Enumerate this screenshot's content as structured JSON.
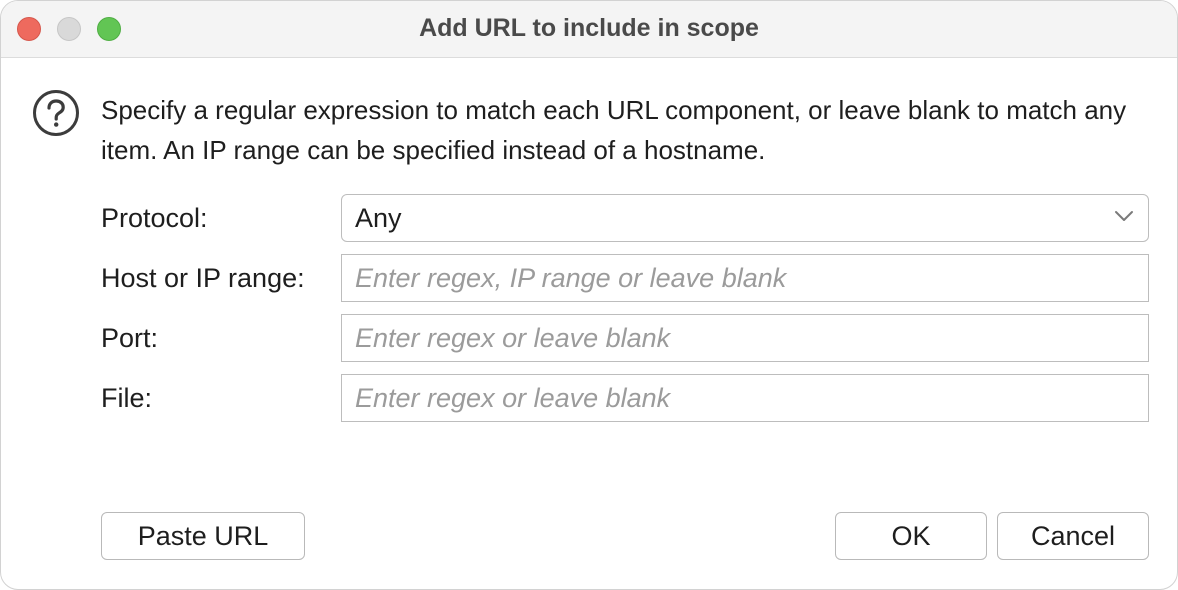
{
  "window": {
    "title": "Add URL to include in scope"
  },
  "description": "Specify a regular expression to match each URL component, or leave blank to match any item. An IP range can be specified instead of a hostname.",
  "icons": {
    "help": "question-circle-icon",
    "select_arrow": "chevron-down-icon"
  },
  "form": {
    "protocol": {
      "label": "Protocol:",
      "value": "Any"
    },
    "host": {
      "label": "Host or IP range:",
      "value": "",
      "placeholder": "Enter regex, IP range or leave blank"
    },
    "port": {
      "label": "Port:",
      "value": "",
      "placeholder": "Enter regex or leave blank"
    },
    "file": {
      "label": "File:",
      "value": "",
      "placeholder": "Enter regex or leave blank"
    }
  },
  "buttons": {
    "paste_url": "Paste URL",
    "ok": "OK",
    "cancel": "Cancel"
  },
  "colors": {
    "close": "#ee6a5e",
    "minimize": "#d9d9d9",
    "zoom": "#62c554"
  }
}
